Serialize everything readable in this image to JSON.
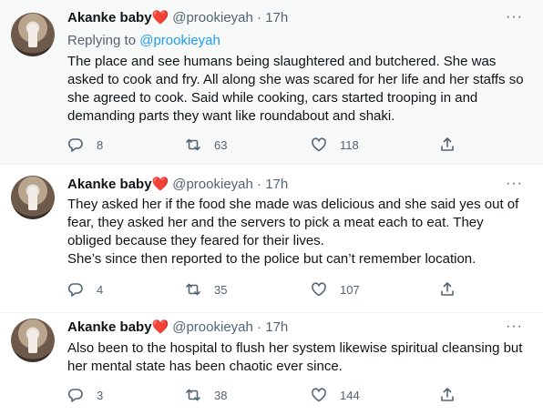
{
  "tweets": [
    {
      "name": "Akanke baby",
      "heart": "❤️",
      "handle": "@prookieyah",
      "sep": "·",
      "time": "17h",
      "more": "···",
      "reply_prefix": "Replying to ",
      "reply_handle": "@prookieyah",
      "lines": [
        "The place and see humans being slaughtered and butchered. She was",
        "asked to cook and fry. All along she was scared for her life and her staffs so",
        "she agreed to cook. Said while cooking, cars started trooping in and",
        "demanding parts they want like roundabout and shaki."
      ],
      "replies": "8",
      "retweets": "63",
      "likes": "118"
    },
    {
      "name": "Akanke baby",
      "heart": "❤️",
      "handle": "@prookieyah",
      "sep": "·",
      "time": "17h",
      "more": "···",
      "lines": [
        "They asked her if the food she made was delicious and she said yes out of",
        "fear, they asked her and the servers to pick a meat each to eat. They",
        "obliged because they feared for their lives.",
        "She’s since then reported to the police but can’t remember location."
      ],
      "replies": "4",
      "retweets": "35",
      "likes": "107"
    },
    {
      "name": "Akanke baby",
      "heart": "❤️",
      "handle": "@prookieyah",
      "sep": "·",
      "time": "17h",
      "more": "···",
      "lines": [
        "Also been to the hospital to flush her system likewise spiritual cleansing but",
        "her mental state has been chaotic ever since."
      ],
      "replies": "3",
      "retweets": "38",
      "likes": "144"
    }
  ],
  "icons": {
    "reply": "reply-icon",
    "retweet": "retweet-icon",
    "like": "like-icon",
    "share": "share-icon"
  },
  "colors": {
    "link": "#1d9bf0",
    "muted": "#536471",
    "heart": "#e0245e",
    "highlight_bg": "#f7f9f9"
  }
}
